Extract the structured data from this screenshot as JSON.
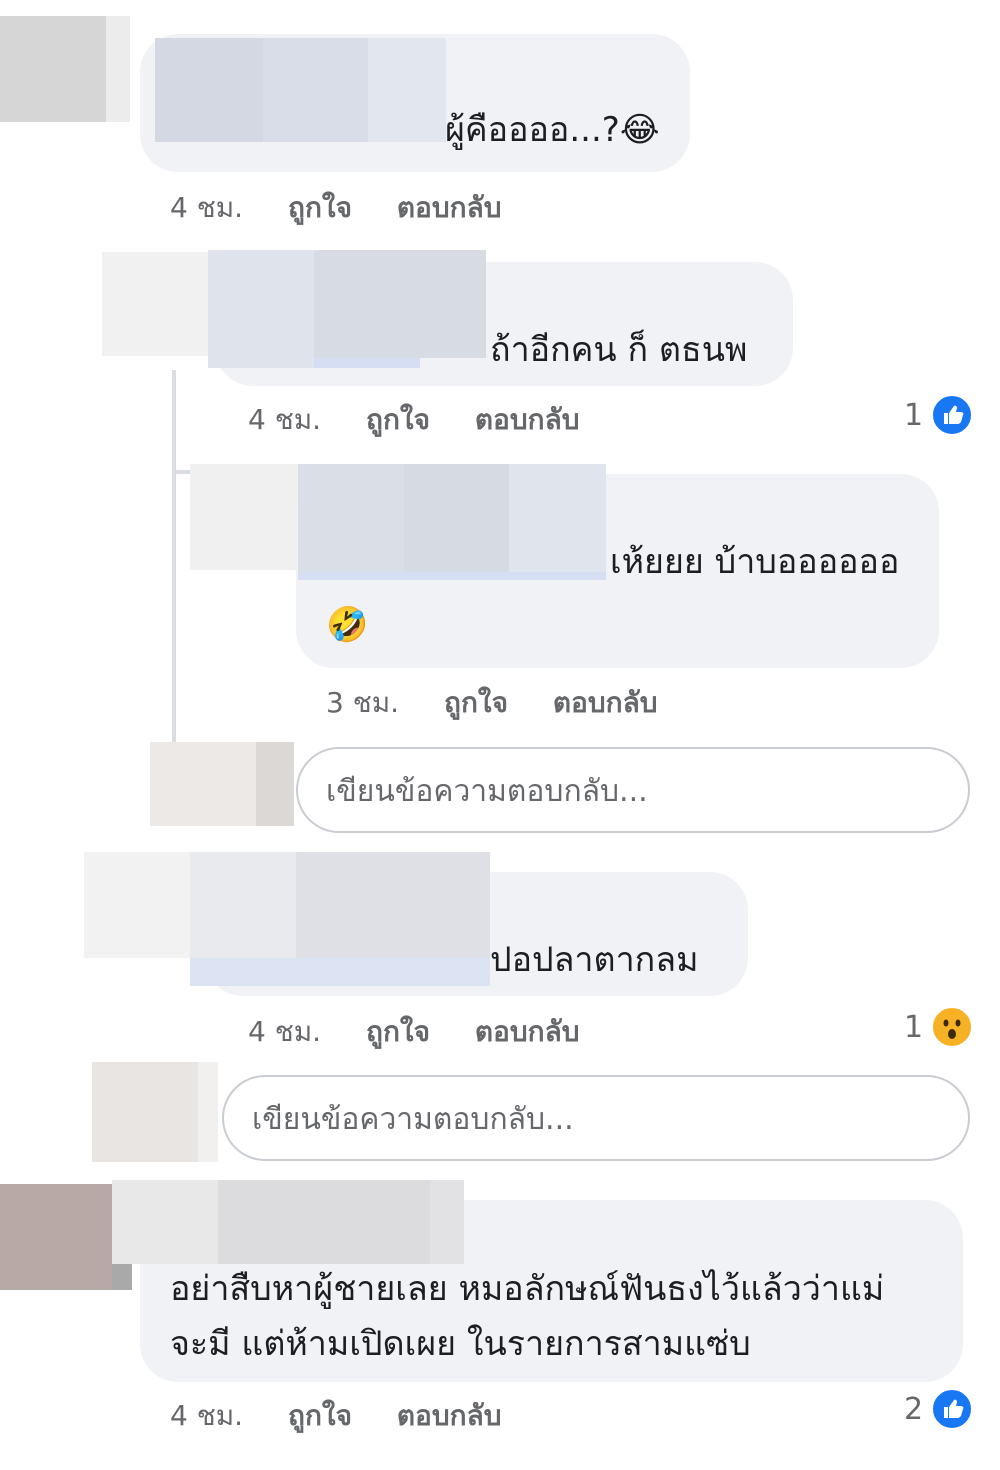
{
  "comments": [
    {
      "text": "ผู้คืออออ...?😂",
      "time": "4 ชม.",
      "like": "ถูกใจ",
      "reply": "ตอบกลับ"
    },
    {
      "text": "ถ้าอีกคน ก็ ตธนพ",
      "time": "4 ชม.",
      "like": "ถูกใจ",
      "reply": "ตอบกลับ",
      "reaction_count": "1",
      "reaction_icon": "like-icon"
    },
    {
      "text_line1": "เห้ยยย บ้าบออออออ",
      "text_line2": "🤣",
      "time": "3 ชม.",
      "like": "ถูกใจ",
      "reply": "ตอบกลับ"
    },
    {
      "text": "ปอปลาตากลม",
      "time": "4 ชม.",
      "like": "ถูกใจ",
      "reply": "ตอบกลับ",
      "reaction_count": "1",
      "reaction_icon": "wow-icon"
    },
    {
      "text_line1": "อย่าสืบหาผู้ชายเลย หมอลักษณ์ฟันธงไว้แล้วว่าแม่",
      "text_line2": "จะมี แต่ห้ามเปิดเผย ในรายการสามแซ่บ",
      "time": "4 ชม.",
      "like": "ถูกใจ",
      "reply": "ตอบกลับ",
      "reaction_count": "2",
      "reaction_icon": "like-icon"
    }
  ],
  "reply_boxes": [
    {
      "placeholder": "เขียนข้อความตอบกลับ..."
    },
    {
      "placeholder": "เขียนข้อความตอบกลับ..."
    }
  ],
  "colors": {
    "bubble": "#f0f2f5",
    "meta_text": "#65676b",
    "like_blue": "#1877f2",
    "wow_yellow": "#f7b125"
  }
}
